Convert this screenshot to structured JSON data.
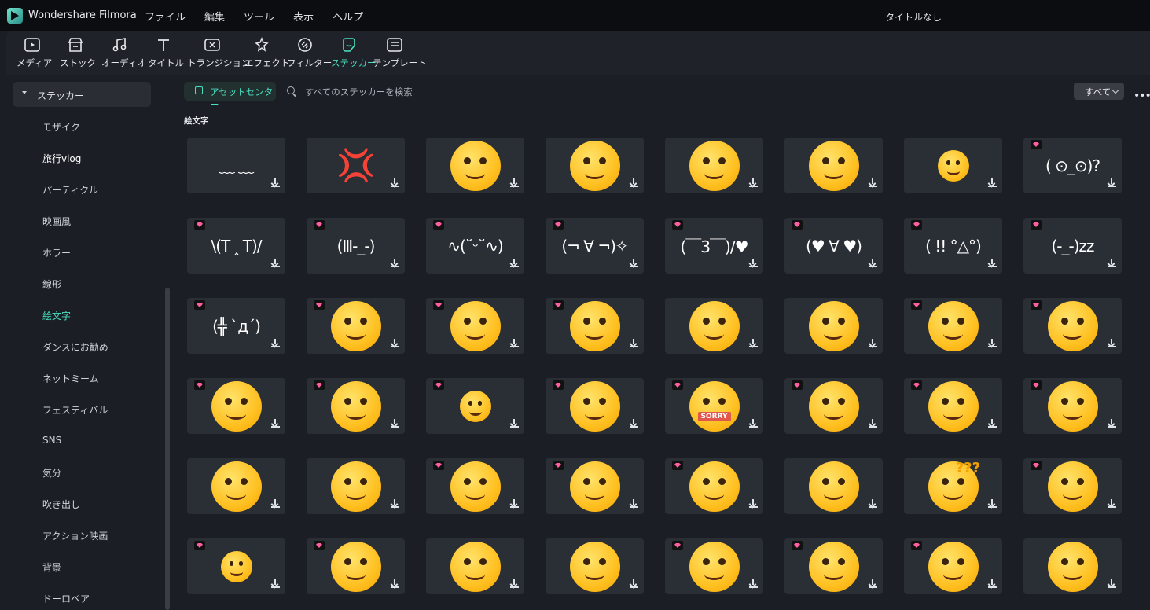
{
  "app": {
    "name": "Wondershare Filmora",
    "document_title": "タイトルなし"
  },
  "menu": [
    "ファイル",
    "編集",
    "ツール",
    "表示",
    "ヘルプ"
  ],
  "toolbar": [
    {
      "label": "メディア",
      "icon": "media-icon"
    },
    {
      "label": "ストック",
      "icon": "stock-icon"
    },
    {
      "label": "オーディオ",
      "icon": "audio-icon"
    },
    {
      "label": "タイトル",
      "icon": "title-icon"
    },
    {
      "label": "トランジション",
      "icon": "transition-icon"
    },
    {
      "label": "エフェクト",
      "icon": "effect-icon"
    },
    {
      "label": "フィルター",
      "icon": "filter-icon"
    },
    {
      "label": "ステッカー",
      "icon": "sticker-icon",
      "active": true
    },
    {
      "label": "テンプレート",
      "icon": "template-icon"
    }
  ],
  "sidebar": {
    "header": "ステッカー",
    "items": [
      {
        "label": "モザイク"
      },
      {
        "label": "旅行vlog",
        "bold": true
      },
      {
        "label": "パーティクル"
      },
      {
        "label": "映画風"
      },
      {
        "label": "ホラー"
      },
      {
        "label": "線形"
      },
      {
        "label": "絵文字",
        "active": true
      },
      {
        "label": "ダンスにお勧め"
      },
      {
        "label": "ネットミーム"
      },
      {
        "label": "フェスティバル"
      },
      {
        "label": "SNS"
      },
      {
        "label": "気分"
      },
      {
        "label": "吹き出し"
      },
      {
        "label": "アクション映画"
      },
      {
        "label": "背景"
      },
      {
        "label": "ドーロベア"
      }
    ]
  },
  "main": {
    "asset_center_label": "アセットセンター",
    "search_placeholder": "すべてのステッカーを検索",
    "filter_value": "すべて",
    "section_label": "絵文字"
  },
  "colors": {
    "accent": "#48e0c1",
    "tile_bg": "#2a2e35",
    "panel_bg": "#1b1e24",
    "premium": "#ff5fa2"
  },
  "stickers": [
    [
      {
        "kind": "kao",
        "text": "﹏       ﹏",
        "premium": false
      },
      {
        "kind": "anger",
        "premium": false
      },
      {
        "kind": "face",
        "premium": false
      },
      {
        "kind": "face",
        "premium": false
      },
      {
        "kind": "face",
        "premium": false
      },
      {
        "kind": "face",
        "premium": false
      },
      {
        "kind": "face",
        "small": true,
        "premium": false
      },
      {
        "kind": "kao",
        "text": "( ⊙_⊙)?",
        "premium": true
      }
    ],
    [
      {
        "kind": "kao",
        "text": "\\(T ‸ T)/",
        "premium": true
      },
      {
        "kind": "kao",
        "text": "(Ⅲ-_-)",
        "premium": true
      },
      {
        "kind": "kao",
        "text": "∿(˘ᵕ˘∿)",
        "premium": true
      },
      {
        "kind": "kao",
        "text": "(¬ ∀ ¬)✧",
        "premium": true
      },
      {
        "kind": "kao",
        "text": "(￣3￣)/♥",
        "premium": true
      },
      {
        "kind": "kao",
        "text": "(♥ ∀ ♥)",
        "premium": true
      },
      {
        "kind": "kao",
        "text": "( !! °△°)",
        "premium": true
      },
      {
        "kind": "kao",
        "text": "(-_-)zz",
        "premium": true
      }
    ],
    [
      {
        "kind": "kao",
        "text": "(╬ `д´)",
        "premium": true
      },
      {
        "kind": "face",
        "premium": true
      },
      {
        "kind": "face",
        "premium": true
      },
      {
        "kind": "face",
        "premium": true
      },
      {
        "kind": "face",
        "premium": false
      },
      {
        "kind": "face",
        "premium": false
      },
      {
        "kind": "face",
        "premium": true
      },
      {
        "kind": "face",
        "premium": true
      }
    ],
    [
      {
        "kind": "face",
        "premium": true
      },
      {
        "kind": "face",
        "premium": true
      },
      {
        "kind": "face",
        "small": true,
        "premium": true
      },
      {
        "kind": "face",
        "premium": true
      },
      {
        "kind": "face",
        "label": "SORRY",
        "premium": true
      },
      {
        "kind": "face",
        "premium": true
      },
      {
        "kind": "face",
        "premium": true
      },
      {
        "kind": "face",
        "premium": true
      }
    ],
    [
      {
        "kind": "face",
        "premium": false
      },
      {
        "kind": "face",
        "premium": false
      },
      {
        "kind": "face",
        "premium": true
      },
      {
        "kind": "face",
        "premium": true
      },
      {
        "kind": "face",
        "premium": true
      },
      {
        "kind": "face",
        "premium": false
      },
      {
        "kind": "face",
        "label": "???",
        "premium": false
      },
      {
        "kind": "face",
        "premium": true
      }
    ],
    [
      {
        "kind": "face",
        "small": true,
        "premium": true
      },
      {
        "kind": "face",
        "premium": true
      },
      {
        "kind": "face",
        "premium": false
      },
      {
        "kind": "face",
        "premium": false
      },
      {
        "kind": "face",
        "premium": true
      },
      {
        "kind": "face",
        "premium": true
      },
      {
        "kind": "face",
        "premium": true
      },
      {
        "kind": "face",
        "premium": false
      }
    ]
  ]
}
